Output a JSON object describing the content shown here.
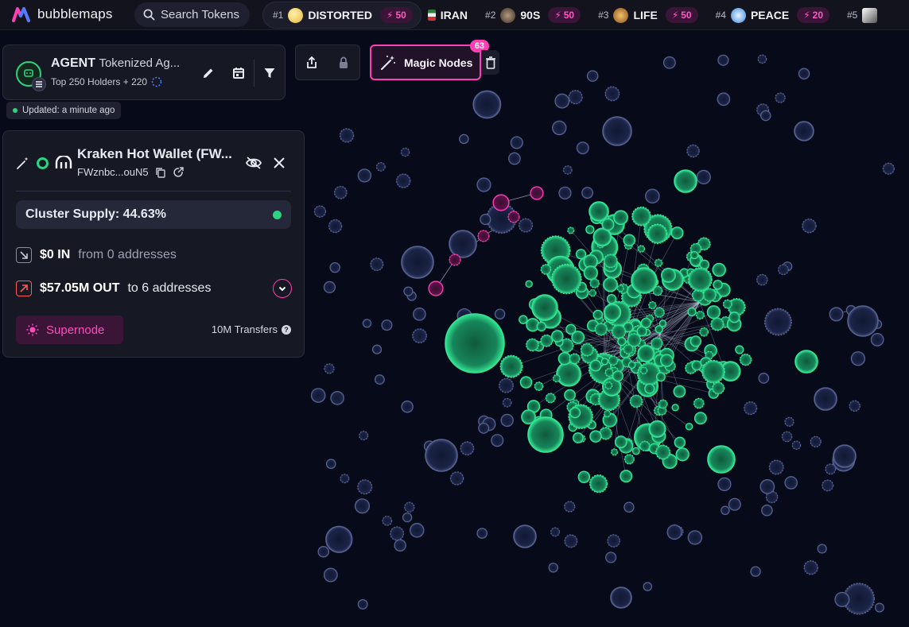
{
  "brand": {
    "name": "bubblemaps"
  },
  "search": {
    "placeholder": "Search Tokens"
  },
  "trending": [
    {
      "rank": "#1",
      "name": "DISTORTED",
      "boost": "50",
      "avatar_color": "#f2c94c"
    },
    {
      "rank": "",
      "name": "IRAN",
      "boost": "",
      "avatar_color": "#2f7d3d"
    },
    {
      "rank": "#2",
      "name": "90S",
      "boost": "50",
      "avatar_color": "#8a6f57"
    },
    {
      "rank": "#3",
      "name": "LIFE",
      "boost": "50",
      "avatar_color": "#c98b2d"
    },
    {
      "rank": "#4",
      "name": "PEACE",
      "boost": "20",
      "avatar_color": "#3b8be0"
    },
    {
      "rank": "#5",
      "name": "",
      "boost": "",
      "avatar_color": "#dcdcdc"
    }
  ],
  "token": {
    "symbol": "AGENT",
    "name": "Tokenized Ag...",
    "holders": "Top 250 Holders + 220",
    "updated": "Updated: a minute ago"
  },
  "magic_nodes": {
    "label": "Magic Nodes",
    "count": "63"
  },
  "wallet": {
    "title": "Kraken Hot Wallet (FW...",
    "address": "FWznbc...ouN5",
    "cluster_supply": "Cluster Supply: 44.63%",
    "in_amount": "$0 IN",
    "in_from": "from 0 addresses",
    "out_amount": "$57.05M OUT",
    "out_to": "to 6 addresses",
    "supernode_label": "Supernode",
    "transfers": "10M Transfers"
  },
  "colors": {
    "accent_pink": "#ff3fb4",
    "accent_green": "#2bd47f",
    "background": "#070a19",
    "panel": "#161823"
  }
}
